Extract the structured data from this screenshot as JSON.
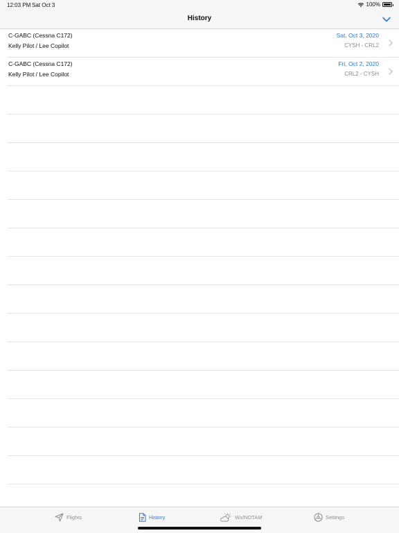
{
  "status_bar": {
    "time": "12:03 PM",
    "date": "Sat Oct 3",
    "battery": "100%",
    "icons": [
      "wifi-icon",
      "battery-icon"
    ]
  },
  "nav": {
    "title": "History",
    "collapse_icon": "chevron-down-icon"
  },
  "history": [
    {
      "aircraft": "C-GABC (Cessna C172)",
      "crew": "Kelly Pilot / Lee Copilot",
      "date": "Sat, Oct 3, 2020",
      "route": "CYSH - CRL2"
    },
    {
      "aircraft": "C-GABC (Cessna C172)",
      "crew": "Kelly Pilot / Lee Copilot",
      "date": "Fri, Oct 2, 2020",
      "route": "CRL2 - CYSH"
    }
  ],
  "tabs": [
    {
      "label": "Flights",
      "icon": "paper-plane-icon",
      "active": false
    },
    {
      "label": "History",
      "icon": "document-icon",
      "active": true
    },
    {
      "label": "Wx/NOTAM",
      "icon": "cloud-sun-icon",
      "active": false
    },
    {
      "label": "Settings",
      "icon": "gear-icon",
      "active": false
    }
  ],
  "colors": {
    "accent": "#2a7bd9",
    "secondary_text": "#8c8c91",
    "bar_background": "#f6f6f7"
  }
}
